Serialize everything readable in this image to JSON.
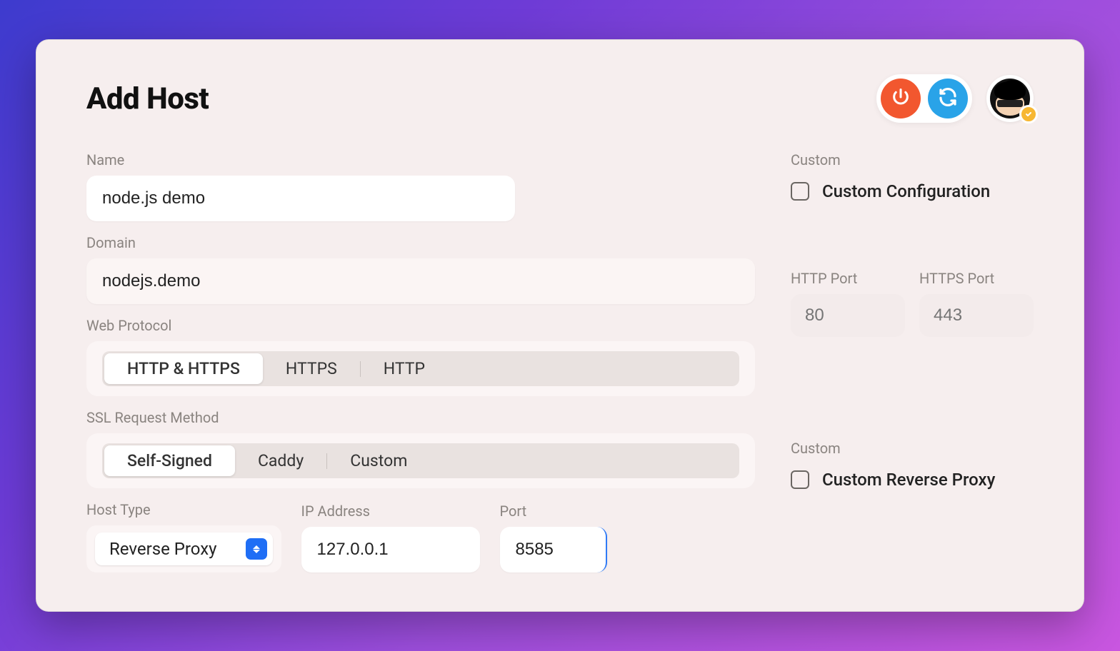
{
  "header": {
    "title": "Add Host"
  },
  "labels": {
    "name": "Name",
    "domain": "Domain",
    "web_protocol": "Web Protocol",
    "http_port": "HTTP Port",
    "https_port": "HTTPS Port",
    "ssl_method": "SSL Request Method",
    "host_type": "Host Type",
    "ip_address": "IP Address",
    "port": "Port",
    "custom_section": "Custom",
    "custom_section2": "Custom"
  },
  "fields": {
    "name_value": "node.js demo",
    "domain_value": "nodejs.demo",
    "http_port_placeholder": "80",
    "https_port_placeholder": "443",
    "host_type_value": "Reverse Proxy",
    "ip_value": "127.0.0.1",
    "port_value": "8585"
  },
  "web_protocol": {
    "options": [
      "HTTP & HTTPS",
      "HTTPS",
      "HTTP"
    ],
    "selected": 0
  },
  "ssl_method": {
    "options": [
      "Self-Signed",
      "Caddy",
      "Custom"
    ],
    "selected": 0
  },
  "custom": {
    "config_label": "Custom Configuration",
    "reverse_proxy_label": "Custom Reverse Proxy"
  }
}
